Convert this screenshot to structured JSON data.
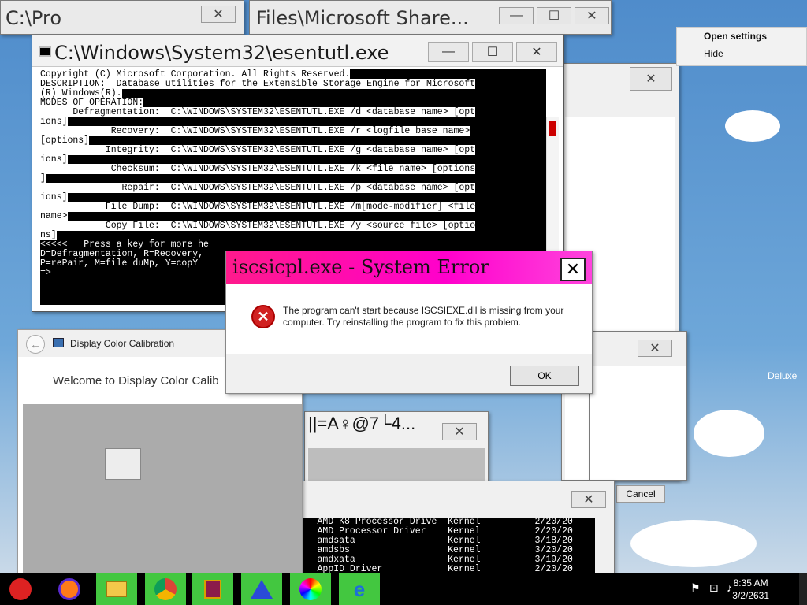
{
  "console": {
    "title": "C:\\Windows\\System32\\esentutl.exe",
    "lines": [
      "Copyright (C) Microsoft Corporation. All Rights Reserved.",
      "",
      "DESCRIPTION:  Database utilities for the Extensible Storage Engine for Microsoft",
      "(R) Windows(R).",
      "",
      "MODES OF OPERATION:",
      "      Defragmentation:  C:\\WINDOWS\\SYSTEM32\\ESENTUTL.EXE /d <database name> [opt",
      "ions]",
      "             Recovery:  C:\\WINDOWS\\SYSTEM32\\ESENTUTL.EXE /r <logfile base name>",
      "[options]",
      "            Integrity:  C:\\WINDOWS\\SYSTEM32\\ESENTUTL.EXE /g <database name> [opt",
      "ions]",
      "             Checksum:  C:\\WINDOWS\\SYSTEM32\\ESENTUTL.EXE /k <file name> [options",
      "]",
      "               Repair:  C:\\WINDOWS\\SYSTEM32\\ESENTUTL.EXE /p <database name> [opt",
      "ions]",
      "            File Dump:  C:\\WINDOWS\\SYSTEM32\\ESENTUTL.EXE /m[mode-modifier] <file",
      "name>",
      "            Copy File:  C:\\WINDOWS\\SYSTEM32\\ESENTUTL.EXE /y <source file> [optio",
      "ns]",
      "",
      "<<<<<   Press a key for more he",
      "D=Defragmentation, R=Recovery,",
      "P=rePair, M=file duMp, Y=copY",
      "=>"
    ]
  },
  "error": {
    "title": "iscsicpl.exe - System Error",
    "close": "✕",
    "message": "The program can't start because ISCSIEXE.dll is missing from your computer. Try reinstalling the program to fix this problem.",
    "ok_label": "OK"
  },
  "calibration": {
    "title": "Display Color Calibration",
    "welcome": "Welcome to Display Color Calib"
  },
  "background": {
    "win1_title": "C:\\Pro",
    "win2_title": "Files\\Microsoft Share...",
    "garbled": "||=A♀@7└​4...",
    "cancel_label": "Cancel",
    "side_text": "Deluxe"
  },
  "drivers": {
    "rows": [
      "AmdK8          AMD K8 Processor Drive  Kernel          2/20/20",
      "AmdPPM         AMD Processor Driver    Kernel          2/20/20",
      "amdsata        amdsata                 Kernel          3/18/20",
      "amdsbs         amdsbs                  Kernel          3/20/20",
      "amdxata        amdxata                 Kernel          3/19/20",
      "AppID          AppID Driver            Kernel          2/20/20"
    ]
  },
  "context_menu": {
    "open_settings": "Open settings",
    "hide": "Hide"
  },
  "taskbar": {
    "time": "8:35 AM",
    "date": "3/2/2631"
  },
  "colors": {
    "error_title_bg": "#ff1a8c",
    "taskbar_green": "#43c740"
  }
}
